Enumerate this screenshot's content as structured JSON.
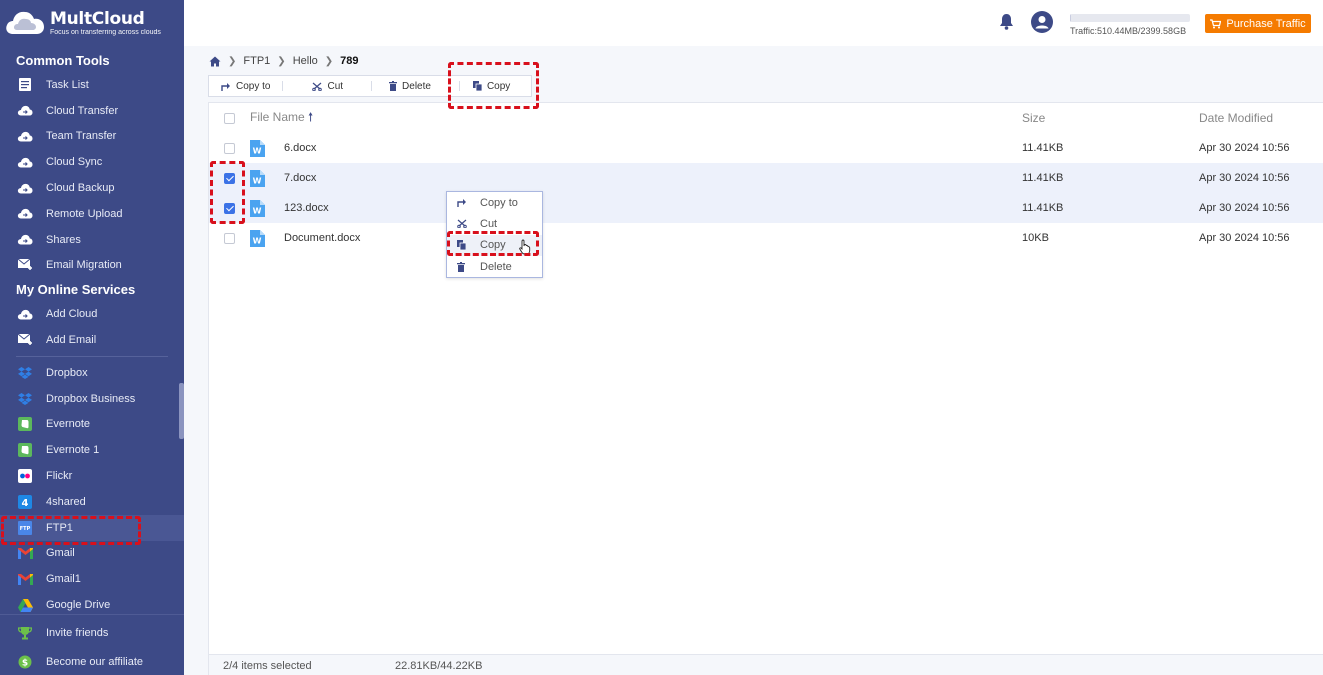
{
  "app": {
    "name": "MultCloud",
    "tagline": "Focus on transferring across clouds"
  },
  "sidebar": {
    "common_tools_title": "Common Tools",
    "common_tools": [
      {
        "label": "Task List",
        "icon": "task-list-icon"
      },
      {
        "label": "Cloud Transfer",
        "icon": "cloud-transfer-icon"
      },
      {
        "label": "Team Transfer",
        "icon": "team-transfer-icon"
      },
      {
        "label": "Cloud Sync",
        "icon": "cloud-sync-icon"
      },
      {
        "label": "Cloud Backup",
        "icon": "cloud-backup-icon"
      },
      {
        "label": "Remote Upload",
        "icon": "remote-upload-icon"
      },
      {
        "label": "Shares",
        "icon": "shares-icon"
      },
      {
        "label": "Email Migration",
        "icon": "email-migration-icon"
      }
    ],
    "online_services_title": "My Online Services",
    "online_actions": [
      {
        "label": "Add Cloud",
        "icon": "add-cloud-icon"
      },
      {
        "label": "Add Email",
        "icon": "add-email-icon"
      }
    ],
    "services": [
      {
        "label": "Dropbox",
        "icon": "dropbox-icon"
      },
      {
        "label": "Dropbox Business",
        "icon": "dropbox-business-icon"
      },
      {
        "label": "Evernote",
        "icon": "evernote-icon"
      },
      {
        "label": "Evernote 1",
        "icon": "evernote-icon"
      },
      {
        "label": "Flickr",
        "icon": "flickr-icon"
      },
      {
        "label": "4shared",
        "icon": "4shared-icon"
      },
      {
        "label": "FTP1",
        "icon": "ftp-icon",
        "active": true
      },
      {
        "label": "Gmail",
        "icon": "gmail-icon"
      },
      {
        "label": "Gmail1",
        "icon": "gmail-icon"
      },
      {
        "label": "Google Drive",
        "icon": "google-drive-icon"
      }
    ],
    "bottom": [
      {
        "label": "Invite friends",
        "icon": "trophy-icon"
      },
      {
        "label": "Become our affiliate",
        "icon": "dollar-icon"
      }
    ]
  },
  "topbar": {
    "traffic": "Traffic:510.44MB/2399.58GB",
    "traffic_fraction": 0.0002,
    "purchase_label": "Purchase Traffic"
  },
  "breadcrumb": {
    "items": [
      "FTP1",
      "Hello"
    ],
    "current": "789"
  },
  "toolbar": {
    "copy_to": "Copy to",
    "cut": "Cut",
    "delete": "Delete",
    "copy": "Copy"
  },
  "table": {
    "headers": {
      "name": "File Name",
      "size": "Size",
      "date": "Date Modified"
    },
    "rows": [
      {
        "name": "6.docx",
        "size": "11.41KB",
        "date": "Apr 30 2024 10:56",
        "selected": false
      },
      {
        "name": "7.docx",
        "size": "11.41KB",
        "date": "Apr 30 2024 10:56",
        "selected": true
      },
      {
        "name": "123.docx",
        "size": "11.41KB",
        "date": "Apr 30 2024 10:56",
        "selected": true
      },
      {
        "name": "Document.docx",
        "size": "10KB",
        "date": "Apr 30 2024 10:56",
        "selected": false
      }
    ]
  },
  "footer": {
    "selected": "2/4 items selected",
    "size": "22.81KB/44.22KB"
  },
  "context_menu": {
    "copy_to": "Copy to",
    "cut": "Cut",
    "copy": "Copy",
    "delete": "Delete"
  },
  "colors": {
    "sidebar": "#3d4a87",
    "accent": "#3b72e6",
    "purchase": "#f57b00",
    "highlight": "#d8101c"
  }
}
